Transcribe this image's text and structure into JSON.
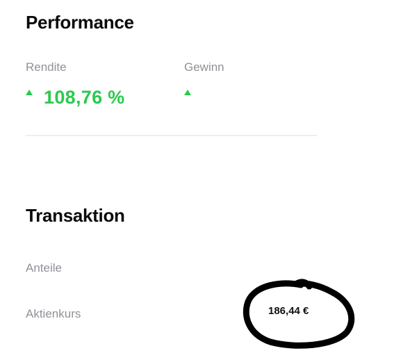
{
  "performance": {
    "title": "Performance",
    "rendite": {
      "label": "Rendite",
      "value": "108,76 %",
      "trend_icon": "triangle-up-icon"
    },
    "gewinn": {
      "label": "Gewinn",
      "value": "",
      "trend_icon": "triangle-up-icon"
    },
    "positive_color": "#2bc94f"
  },
  "transaktion": {
    "title": "Transaktion",
    "anteile": {
      "label": "Anteile",
      "value": ""
    },
    "aktienkurs": {
      "label": "Aktienkurs",
      "value": "186,44 €"
    }
  },
  "annotation": {
    "shape": "hand-drawn-circle",
    "color": "#000000"
  }
}
